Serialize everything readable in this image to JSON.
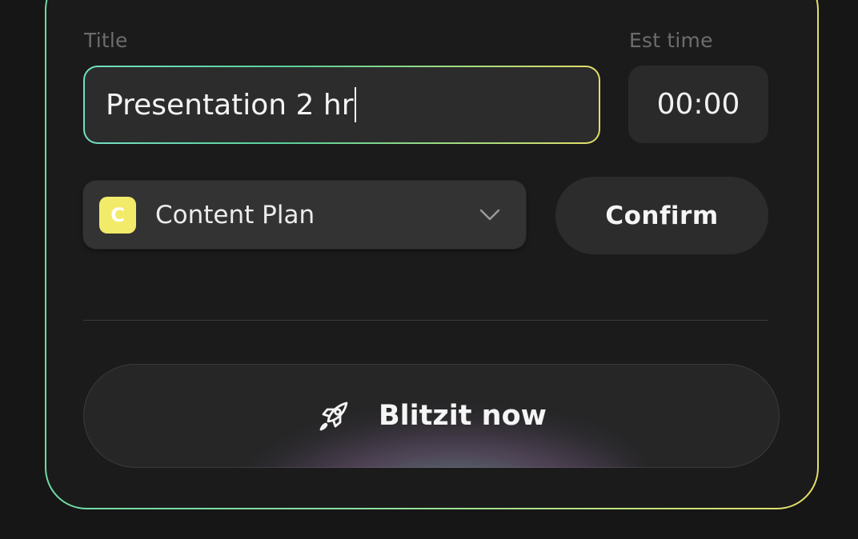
{
  "form": {
    "title_label": "Title",
    "title_value": "Presentation 2 hr",
    "est_label": "Est time",
    "est_value": "00:00"
  },
  "project_select": {
    "badge_letter": "C",
    "badge_color": "#f2eb6a",
    "selected": "Content Plan",
    "icon": "chevron-down-icon"
  },
  "actions": {
    "confirm_label": "Confirm",
    "blitz_label": "Blitzit now",
    "blitz_icon": "rocket-icon"
  },
  "colors": {
    "border_gradient_start": "#6fd9a6",
    "border_gradient_end": "#e6df6a"
  }
}
